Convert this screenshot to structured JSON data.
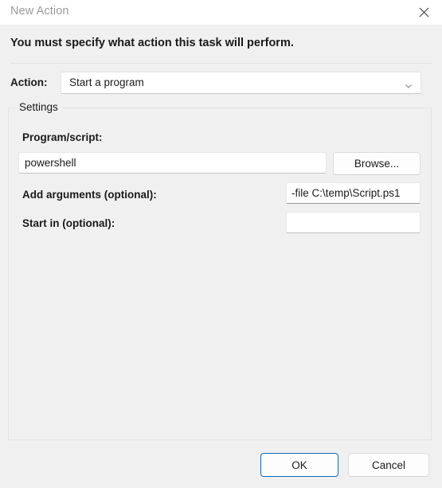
{
  "window": {
    "title": "New Action",
    "close_icon": "close-icon"
  },
  "header": {
    "instruction": "You must specify what action this task will perform."
  },
  "action_row": {
    "label": "Action:",
    "selected": "Start a program",
    "chevron_icon": "chevron-down-icon"
  },
  "settings": {
    "legend": "Settings",
    "program_label": "Program/script:",
    "program_value": "powershell",
    "program_placeholder": "",
    "browse_label": "Browse...",
    "arguments_label": "Add arguments (optional):",
    "arguments_value": "-file C:\\temp\\Script.ps1",
    "arguments_placeholder": "",
    "start_in_label": "Start in (optional):",
    "start_in_value": "",
    "start_in_placeholder": ""
  },
  "footer": {
    "ok_label": "OK",
    "cancel_label": "Cancel"
  },
  "colors": {
    "dialog_background": "#f0f0f0",
    "titlebar_background": "#ffffff",
    "title_text": "#9a9a9a",
    "body_text": "#1a1a1a",
    "accent_focus": "#0f6cbd",
    "field_background": "#ffffff",
    "border": "#e3e3e3"
  }
}
